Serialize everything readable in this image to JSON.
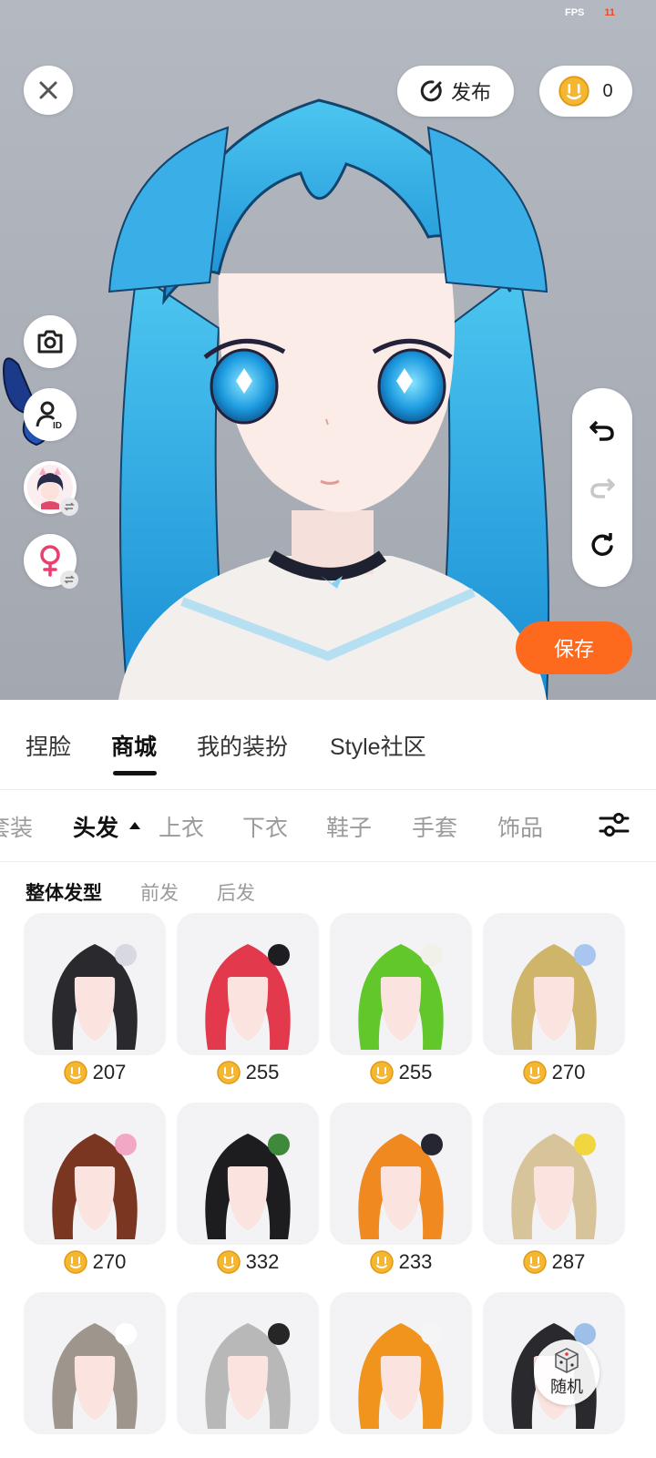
{
  "status": {
    "fps_label": "FPS",
    "fps_value": "11"
  },
  "top_bar": {
    "publish_label": "发布",
    "coin_balance": "0"
  },
  "side_tools": {
    "camera_icon": "camera-icon",
    "id_icon": "person-id-icon",
    "gender_icon": "female-icon",
    "swap_icon": "swap-arrows-icon"
  },
  "history": {
    "undo_icon": "undo-icon",
    "redo_icon": "redo-icon",
    "reset_icon": "reset-icon"
  },
  "save_label": "保存",
  "main_tabs": [
    {
      "label": "捏脸",
      "active": false
    },
    {
      "label": "商城",
      "active": true
    },
    {
      "label": "我的装扮",
      "active": false
    },
    {
      "label": "Style社区",
      "active": false
    }
  ],
  "categories": [
    {
      "label": "套装",
      "active": false
    },
    {
      "label": "头发",
      "active": true
    },
    {
      "label": "上衣",
      "active": false
    },
    {
      "label": "下衣",
      "active": false
    },
    {
      "label": "鞋子",
      "active": false
    },
    {
      "label": "手套",
      "active": false
    },
    {
      "label": "饰品",
      "active": false
    }
  ],
  "sub_tabs": [
    {
      "label": "整体发型",
      "active": true
    },
    {
      "label": "前发",
      "active": false
    },
    {
      "label": "后发",
      "active": false
    }
  ],
  "items": [
    {
      "price": "207",
      "hair": "#2a2a2e",
      "accent": "#d8d8e0"
    },
    {
      "price": "255",
      "hair": "#e23a4c",
      "accent": "#1e1e22"
    },
    {
      "price": "255",
      "hair": "#62c72a",
      "accent": "#f1f1ea"
    },
    {
      "price": "270",
      "hair": "#cfb56a",
      "accent": "#a8c6f0"
    },
    {
      "price": "270",
      "hair": "#7a3620",
      "accent": "#f2a8c4"
    },
    {
      "price": "332",
      "hair": "#1d1d20",
      "accent": "#3f8a3a"
    },
    {
      "price": "233",
      "hair": "#f08a20",
      "accent": "#262633"
    },
    {
      "price": "287",
      "hair": "#d8c49a",
      "accent": "#f2d640"
    },
    {
      "price": "",
      "hair": "#9e968c",
      "accent": "#ffffff"
    },
    {
      "price": "",
      "hair": "#b8b8b8",
      "accent": "#262626"
    },
    {
      "price": "",
      "hair": "#f0941e",
      "accent": "#f5f5f5"
    },
    {
      "price": "",
      "hair": "#2a2a2e",
      "accent": "#9ec0e8"
    }
  ],
  "random_label": "随机",
  "colors": {
    "accent": "#fd6a1d",
    "coin": "#f5b731",
    "active_text": "#111111",
    "inactive_text": "#9b9b9b"
  }
}
